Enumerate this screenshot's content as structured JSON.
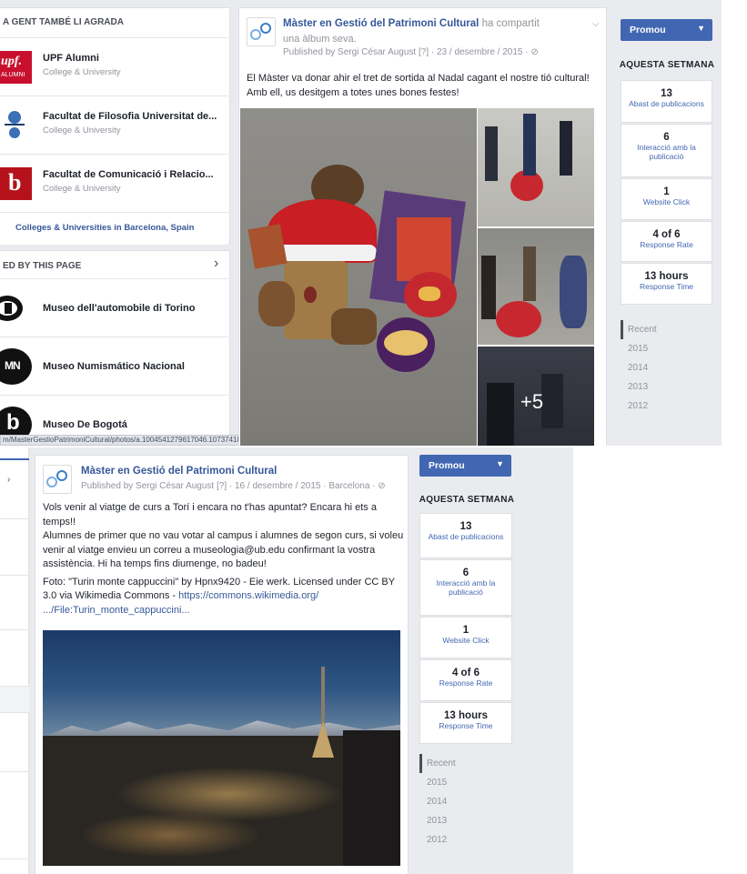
{
  "shot1": {
    "left": {
      "liked_header": "A GENT TAMBÉ LI AGRADA",
      "pages": [
        {
          "name": "UPF Alumni",
          "category": "College & University",
          "logo_text": "upf.",
          "logo_sub": "ALUMNI"
        },
        {
          "name": "Facultat de Filosofia Universitat de...",
          "category": "College & University"
        },
        {
          "name": "Facultat de Comunicació i Relacio...",
          "category": "College & University",
          "logo_text": "b"
        }
      ],
      "colleges_link": "Colleges & Universities in Barcelona, Spain",
      "liked_by_header": "ED BY THIS PAGE",
      "liked_by_arrow": "›",
      "liked_by": [
        {
          "name": "Museo dell'automobile di Torino"
        },
        {
          "name": "Museo Numismático Nacional",
          "logo_text": "MN"
        },
        {
          "name": "Museo De Bogotá",
          "logo_text": "b"
        }
      ]
    },
    "post": {
      "author": "Màster en Gestió del Patrimoni Cultural",
      "action": "ha compartit",
      "action2": "una àlbum seva.",
      "meta": "Published by Sergi César August [?] · 23 / desembre / 2015 · ⊘",
      "text": "El Màster va donar ahir el tret de sortida al Nadal cagant el nostre tió cultural! Amb ell, us desitgem a totes unes bones festes!",
      "more_photos": "+5",
      "status_url": "m/MasterGestioPatrimoniCultural/photos/a.1004541279617046.1073741836.343718659123217/1004541342950373/?type=3"
    },
    "right": {
      "promote": "Promou",
      "week_header": "AQUESTA SETMANA",
      "stats": [
        {
          "value": "13",
          "label": "Abast de publicacions"
        },
        {
          "value": "6",
          "label": "Interacció amb la publicació"
        },
        {
          "value": "1",
          "label": "Website Click"
        },
        {
          "value": "4 of 6",
          "label": "Response Rate"
        },
        {
          "value": "13 hours",
          "label": "Response Time"
        }
      ],
      "recent": "Recent",
      "years": [
        "2015",
        "2014",
        "2013",
        "2012"
      ]
    }
  },
  "shot2": {
    "post": {
      "author": "Màster en Gestió del Patrimoni Cultural",
      "meta": "Published by Sergi César August [?] · 16 / desembre / 2015 · Barcelona · ⊘",
      "p1": "Vols venir al viatge de curs a Torí i encara no t'has apuntat? Encara hi ets a temps!!",
      "p2": "Alumnes de primer que no vau votar al campus i alumnes de segon curs, si voleu venir al viatge envieu un correu a museologia@ub.edu confirmant la vostra assistència. Hi ha temps fins diumenge, no badeu!",
      "p3a": "Foto: \"Turin monte cappuccini\" by Hpnx9420 - Eie werk. Licensed under CC BY 3.0 via Wikimedia Commons - ",
      "p3link": "https://commons.wikimedia.org/ .../File:Turin_monte_cappuccini..."
    },
    "right": {
      "promote": "Promou",
      "week_header": "AQUESTA SETMANA",
      "stats": [
        {
          "value": "13",
          "label": "Abast de publicacions"
        },
        {
          "value": "6",
          "label": "Interacció amb la publicació"
        },
        {
          "value": "1",
          "label": "Website Click"
        },
        {
          "value": "4 of 6",
          "label": "Response Rate"
        },
        {
          "value": "13 hours",
          "label": "Response Time"
        }
      ],
      "recent": "Recent",
      "years": [
        "2015",
        "2014",
        "2013",
        "2012"
      ]
    }
  },
  "colors": {
    "fb_blue": "#4267b2",
    "link": "#365899",
    "bg": "#e9ebee"
  }
}
